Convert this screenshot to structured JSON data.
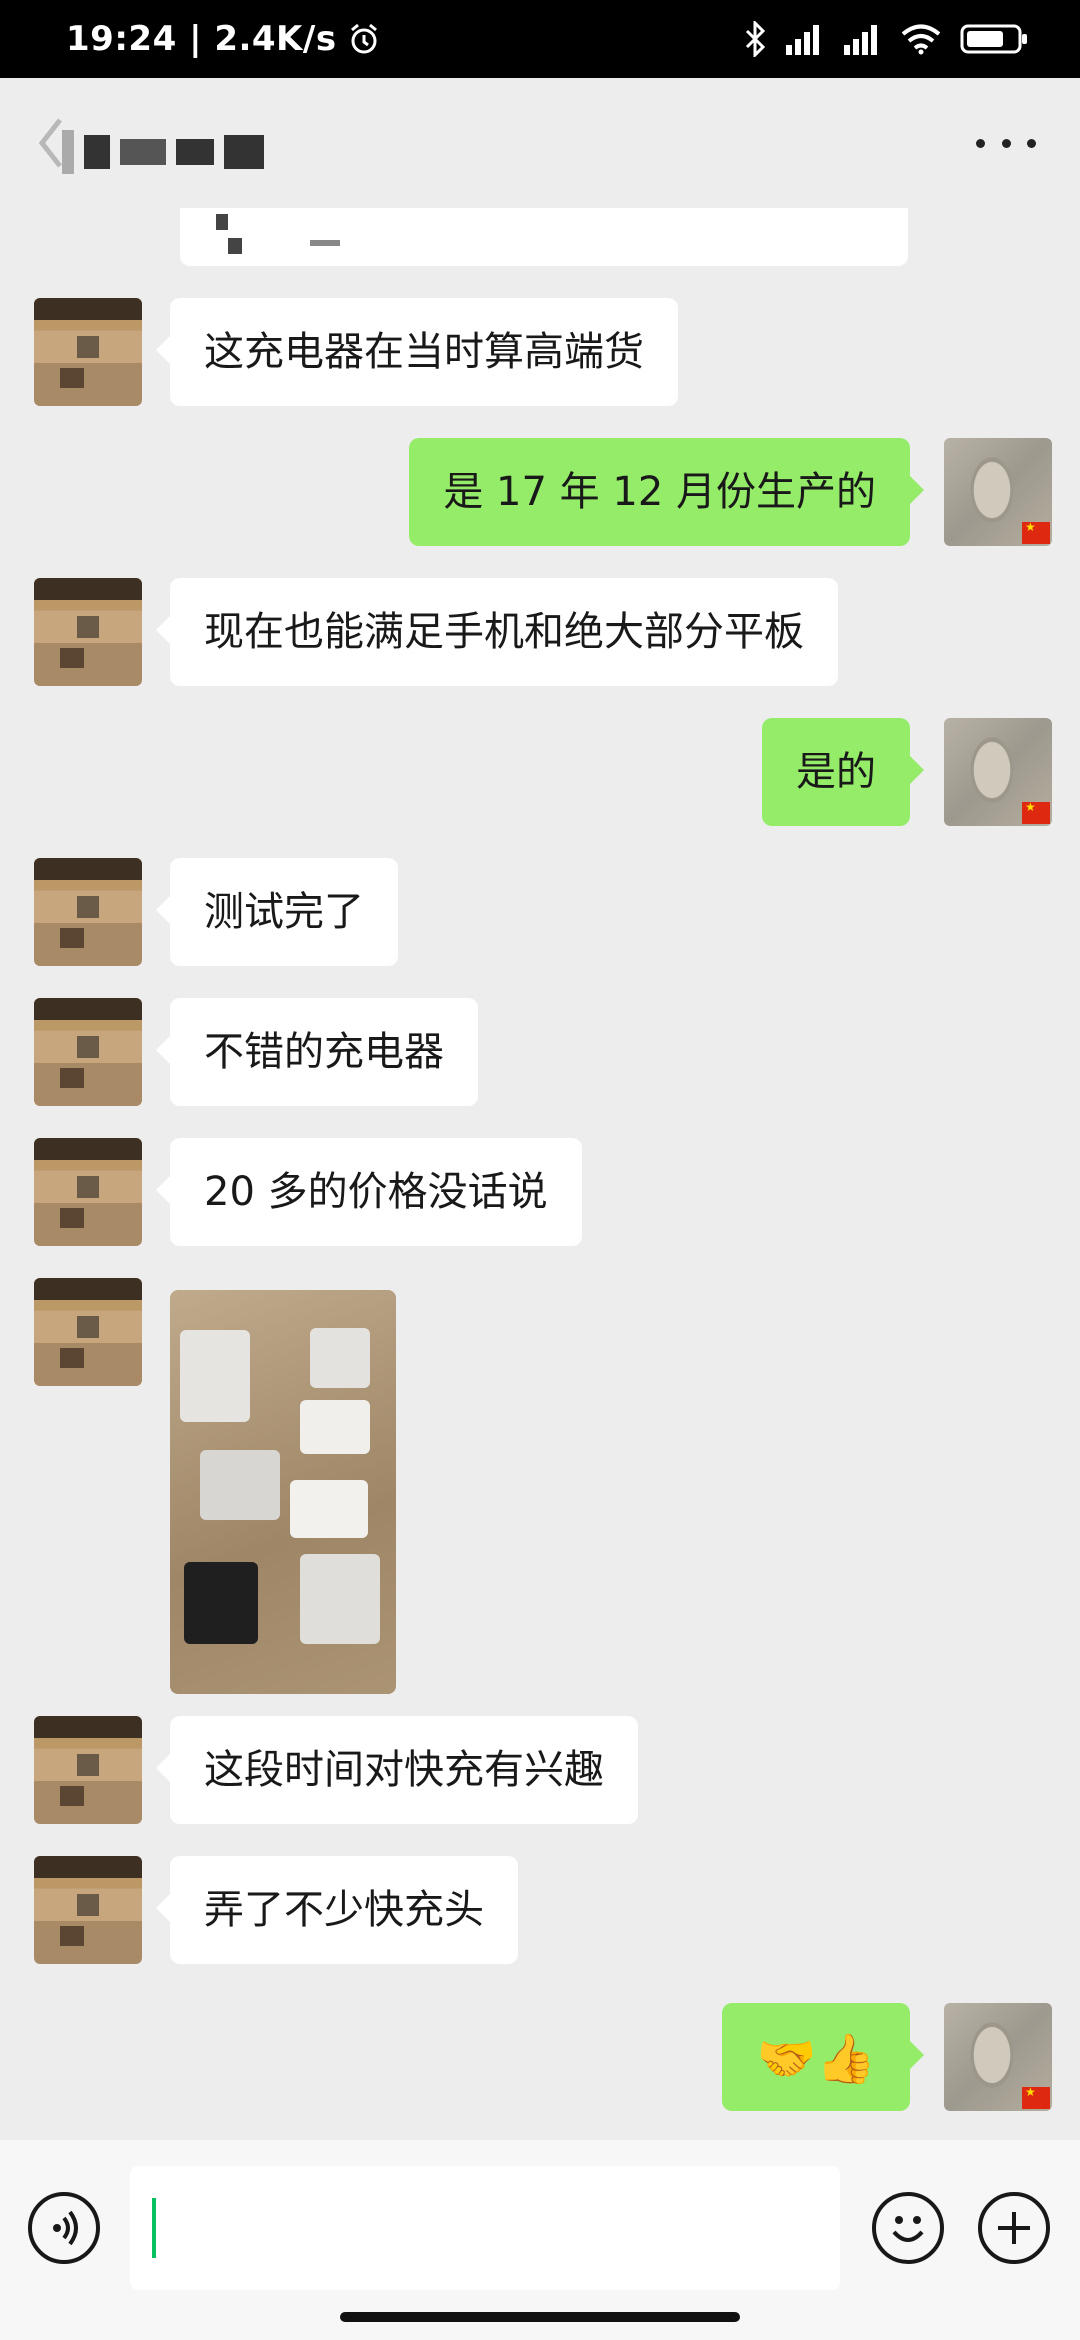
{
  "status_bar": {
    "time": "19:24",
    "separator": " | ",
    "net_speed": "2.4K/s",
    "icons": [
      "alarm-icon",
      "bluetooth-icon",
      "signal-icon",
      "signal-icon",
      "wifi-icon",
      "battery-icon"
    ]
  },
  "header": {
    "title": "",
    "more_icon": "more-icon"
  },
  "messages": [
    {
      "side": "left",
      "type": "text",
      "text": "这充电器在当时算高端货"
    },
    {
      "side": "right",
      "type": "text",
      "text": "是 17 年 12 月份生产的"
    },
    {
      "side": "left",
      "type": "text",
      "text": "现在也能满足手机和绝大部分平板"
    },
    {
      "side": "right",
      "type": "text",
      "text": "是的"
    },
    {
      "side": "left",
      "type": "text",
      "text": "测试完了"
    },
    {
      "side": "left",
      "type": "text",
      "text": "不错的充电器"
    },
    {
      "side": "left",
      "type": "text",
      "text": "20 多的价格没话说"
    },
    {
      "side": "left",
      "type": "image",
      "text": ""
    },
    {
      "side": "left",
      "type": "text",
      "text": "这段时间对快充有兴趣"
    },
    {
      "side": "left",
      "type": "text",
      "text": "弄了不少快充头"
    },
    {
      "side": "right",
      "type": "emoji",
      "text": "🤝👍"
    }
  ],
  "input_bar": {
    "value": "",
    "placeholder": "",
    "voice_icon": "voice-icon",
    "emoji_icon": "emoji-face-icon",
    "plus_icon": "plus-icon"
  },
  "colors": {
    "background": "#ededed",
    "sent_bubble": "#95ec69",
    "received_bubble": "#ffffff",
    "cursor": "#07c160"
  }
}
